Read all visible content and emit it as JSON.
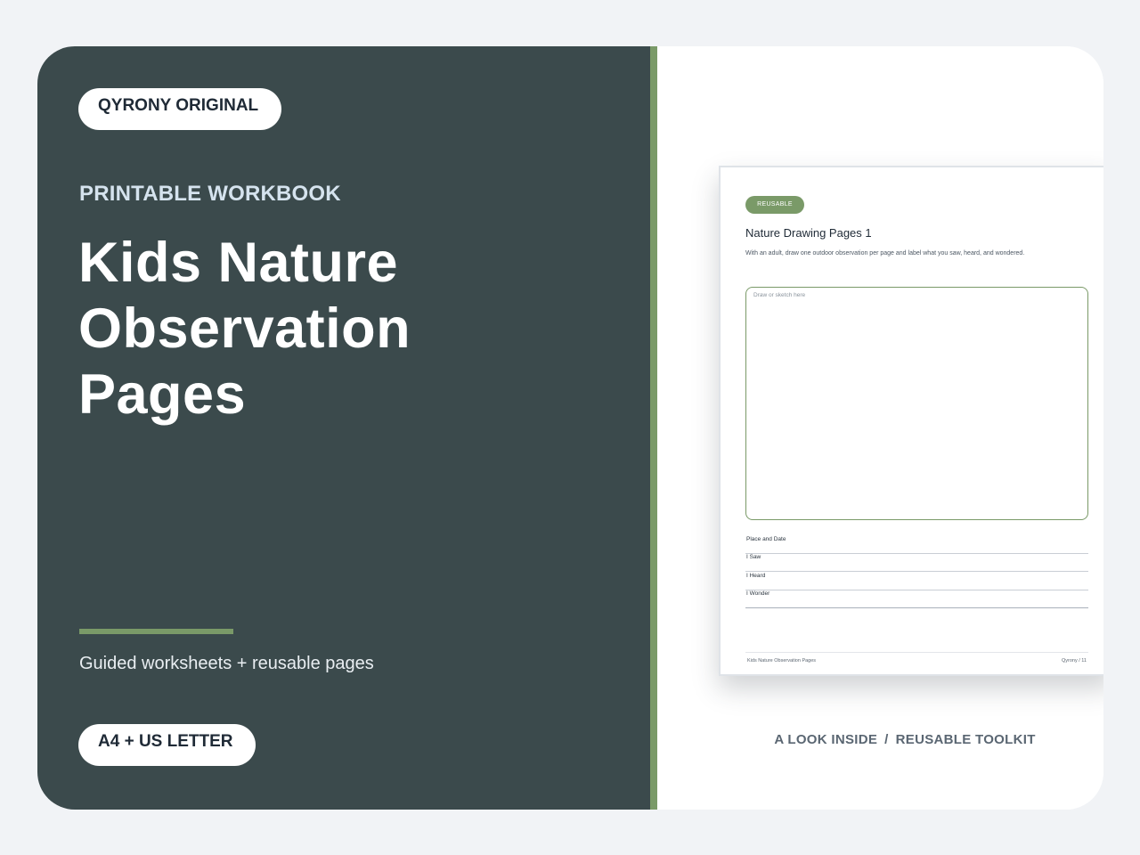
{
  "brand_pill": "QYRONY ORIGINAL",
  "eyebrow": "PRINTABLE WORKBOOK",
  "title_lines": [
    "Kids Nature",
    "Observation",
    "Pages"
  ],
  "subtitle": "Guided worksheets + reusable pages",
  "format_pill": "A4 + US LETTER",
  "colors": {
    "panel": "#3b4a4c",
    "accent": "#7a9a68",
    "background": "#f1f3f6"
  },
  "preview": {
    "badge": "REUSABLE",
    "title": "Nature Drawing Pages 1",
    "instructions": "With an adult, draw one outdoor observation per page and label what you saw, heard, and wondered.",
    "draw_hint": "Draw or sketch here",
    "fields": [
      "Place and Date",
      "I Saw",
      "I Heard",
      "I Wonder"
    ],
    "footer_left": "Kids Nature Observation Pages",
    "footer_right": "Qyrony / 11"
  },
  "caption": {
    "left": "A LOOK INSIDE",
    "separator": "/",
    "right": "REUSABLE TOOLKIT"
  }
}
